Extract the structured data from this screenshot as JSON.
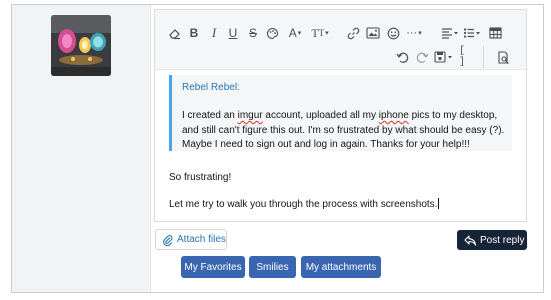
{
  "avatar": {
    "icon": "jewelry-rings-photo"
  },
  "toolbar": {
    "row1_icons": [
      "eraser-icon",
      "bold-icon",
      "italic-icon",
      "underline-icon",
      "strikethrough-icon",
      "palette-icon",
      "font-family-icon",
      "font-size-icon",
      "link-icon",
      "image-icon",
      "smiley-icon",
      "more-options-icon",
      "align-icon",
      "list-icon",
      "table-icon"
    ],
    "row2_icons": [
      "undo-icon",
      "redo-icon",
      "save-draft-icon",
      "bbcode-toggle-icon",
      "preview-icon"
    ]
  },
  "quote": {
    "author": "Rebel Rebel:",
    "text_before_1": "I created an ",
    "misspelled_1": "imgur",
    "text_mid": " account, uploaded all my ",
    "misspelled_2": "iphone",
    "text_after": " pics to my desktop, and still can't figure this out. I'm so frustrated by what should be easy (?). Maybe I need to sign out and log in again. Thanks for your help!!!"
  },
  "body": {
    "line1": "So frustrating!",
    "line2": "Let me try to walk you through the process with screenshots."
  },
  "buttons": {
    "attach": "Attach files",
    "post_reply": "Post reply",
    "my_favorites": "My Favorites",
    "smilies": "Smilies",
    "my_attachments": "My attachments"
  },
  "colors": {
    "link_blue": "#2577b1",
    "quote_border": "#47a7eb",
    "post_button": "#162437",
    "tab_button": "#3a66b1"
  }
}
